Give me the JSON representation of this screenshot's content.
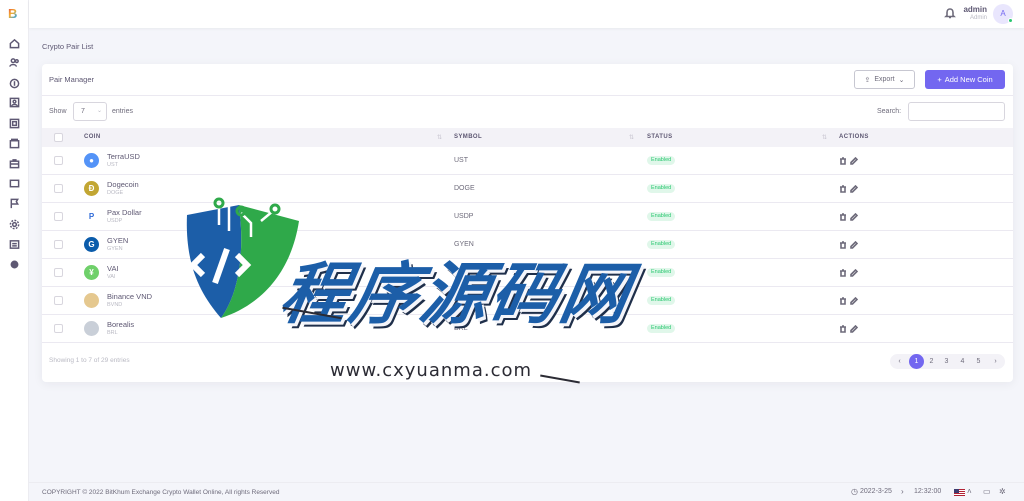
{
  "header": {
    "user_name": "admin",
    "user_role": "Admin",
    "avatar_initial": "A"
  },
  "breadcrumb": "Crypto Pair List",
  "card": {
    "title": "Pair Manager",
    "export_label": "Export",
    "add_label": "Add New Coin",
    "show_label": "Show",
    "entries_value": "7",
    "entries_label": "entries",
    "search_label": "Search:",
    "search_value": ""
  },
  "table": {
    "columns": [
      "COIN",
      "SYMBOL",
      "STATUS",
      "ACTIONS"
    ],
    "rows": [
      {
        "name": "TerraUSD",
        "sub": "UST",
        "symbol": "UST",
        "status": "Enabled",
        "icon": "terrausd-icon",
        "color": "#5493f7",
        "glyph": "●"
      },
      {
        "name": "Dogecoin",
        "sub": "DOGE",
        "symbol": "DOGE",
        "status": "Enabled",
        "icon": "dogecoin-icon",
        "color": "#c2a633",
        "glyph": "Ð"
      },
      {
        "name": "Pax Dollar",
        "sub": "USDP",
        "symbol": "USDP",
        "status": "Enabled",
        "icon": "pax-dollar-icon",
        "color": "#ffffff",
        "glyph": "P"
      },
      {
        "name": "GYEN",
        "sub": "GYEN",
        "symbol": "GYEN",
        "status": "Enabled",
        "icon": "gyen-icon",
        "color": "#0b5cab",
        "glyph": "G"
      },
      {
        "name": "VAI",
        "sub": "VAI",
        "symbol": "VAI",
        "status": "Enabled",
        "icon": "vai-icon",
        "color": "#6fd06a",
        "glyph": "¥"
      },
      {
        "name": "Binance VND",
        "sub": "BVND",
        "symbol": "BVND",
        "status": "Enabled",
        "icon": "binance-vnd-icon",
        "color": "#e5c88f",
        "glyph": ""
      },
      {
        "name": "Borealis",
        "sub": "BRL",
        "symbol": "BRL",
        "status": "Enabled",
        "icon": "borealis-icon",
        "color": "#c9cfd8",
        "glyph": ""
      }
    ]
  },
  "showing_text": "Showing 1 to 7 of 29 entries",
  "pagination": {
    "prev": "‹",
    "pages": [
      "1",
      "2",
      "3",
      "4",
      "5"
    ],
    "active": "1",
    "next": "›"
  },
  "footer": {
    "copyright": "COPYRIGHT © 2022 BitKhum Exchange Crypto Wallet Online, All rights Reserved",
    "date": "2022-3-25",
    "time": "12:32:00"
  },
  "watermark": {
    "title": "程序源码网",
    "url": "www.cxyuanma.com"
  },
  "colors": {
    "primary": "#7367f0",
    "success": "#28c76f",
    "text": "#6e6b7b"
  }
}
